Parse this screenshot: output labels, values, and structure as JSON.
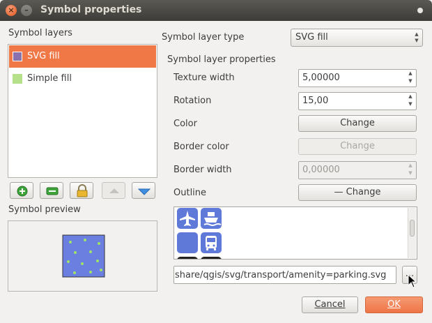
{
  "window": {
    "title": "Symbol properties"
  },
  "left": {
    "layers_label": "Symbol layers",
    "layers": [
      {
        "label": "SVG fill",
        "color": "#8a72ae",
        "selected": true
      },
      {
        "label": "Simple fill",
        "color": "#b7e08a",
        "selected": false
      }
    ],
    "tools": [
      "add-icon",
      "remove-icon",
      "lock-icon",
      "arrow-up-icon",
      "arrow-down-icon"
    ],
    "preview_label": "Symbol preview"
  },
  "right": {
    "layer_type_label": "Symbol layer type",
    "layer_type_value": "SVG fill",
    "props_label": "Symbol layer properties",
    "texture_width_label": "Texture width",
    "texture_width_value": "5,00000",
    "rotation_label": "Rotation",
    "rotation_value": "15,00",
    "color_label": "Color",
    "color_button": "Change",
    "border_color_label": "Border color",
    "border_color_button": "Change",
    "border_width_label": "Border width",
    "border_width_value": "0,00000",
    "outline_label": "Outline",
    "outline_button": "— Change",
    "svg_path": "share/qgis/svg/transport/amenity=parking.svg",
    "browse_label": "..."
  },
  "footer": {
    "cancel": "Cancel",
    "ok": "OK"
  },
  "colors": {
    "accent": "#f07746",
    "svg_blue": "#5f79d9",
    "preview_fill": "#6b7fe0",
    "star": "#9fe36a"
  }
}
